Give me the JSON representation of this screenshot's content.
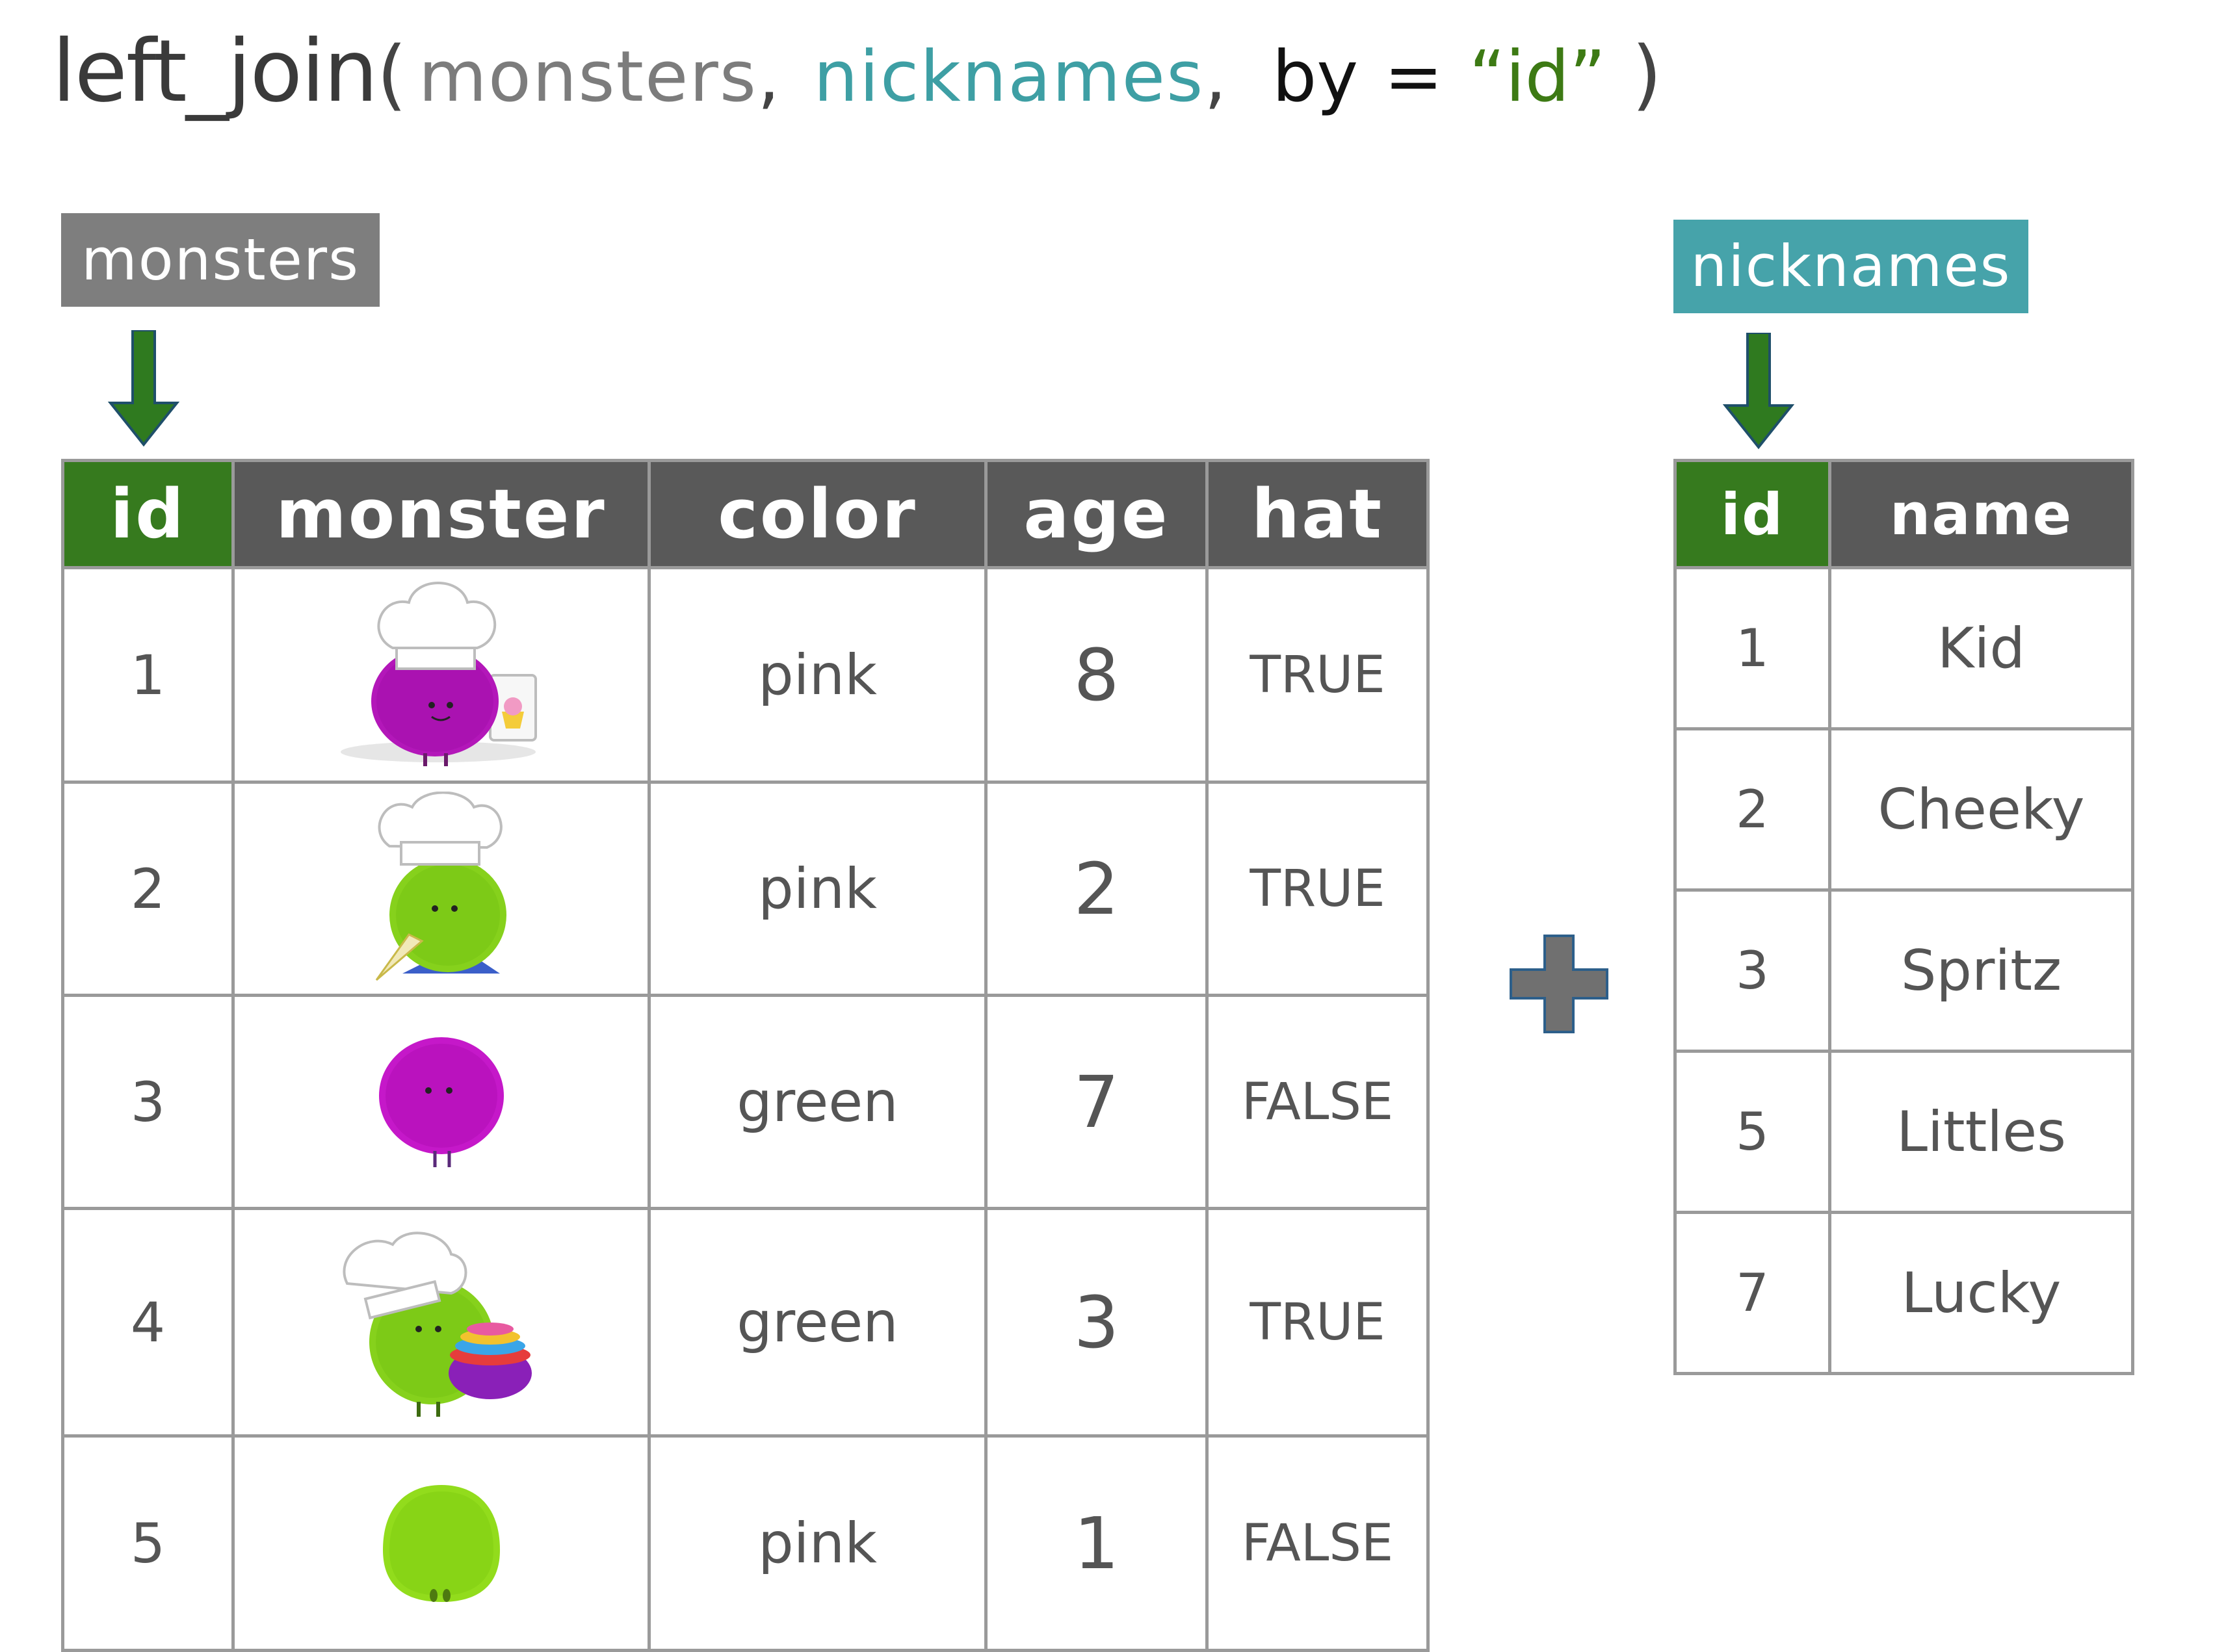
{
  "formula": {
    "fn": "left_join",
    "open_paren": "(",
    "arg1": "monsters",
    "comma1": ",",
    "arg2": "nicknames",
    "comma2": ",",
    "by_kw": "by",
    "equals": "=",
    "by_value": "“id”",
    "close_paren": ")"
  },
  "monsters": {
    "label": "monsters",
    "headers": [
      "id",
      "monster",
      "color",
      "age",
      "hat"
    ],
    "rows": [
      {
        "id": "1",
        "monster": "purple chef monster holding cupcake drawing",
        "color": "pink",
        "age": "8",
        "hat": "TRUE"
      },
      {
        "id": "2",
        "monster": "green chef monster with piping bag",
        "color": "pink",
        "age": "2",
        "hat": "TRUE"
      },
      {
        "id": "3",
        "monster": "magenta fuzzy monster",
        "color": "green",
        "age": "7",
        "hat": "FALSE"
      },
      {
        "id": "4",
        "monster": "green chef monster holding mixing bowls",
        "color": "green",
        "age": "3",
        "hat": "TRUE"
      },
      {
        "id": "5",
        "monster": "lime fuzzy monster",
        "color": "pink",
        "age": "1",
        "hat": "FALSE"
      }
    ]
  },
  "nicknames": {
    "label": "nicknames",
    "headers": [
      "id",
      "name"
    ],
    "rows": [
      {
        "id": "1",
        "name": "Kid"
      },
      {
        "id": "2",
        "name": "Cheeky"
      },
      {
        "id": "3",
        "name": "Spritz"
      },
      {
        "id": "5",
        "name": "Littles"
      },
      {
        "id": "7",
        "name": "Lucky"
      }
    ]
  },
  "colors": {
    "id_header": "#367a1e",
    "header": "#595959",
    "monsters_label": "#7e7e7e",
    "nicknames_label": "#46a3aa",
    "arrow": "#2f7a1f",
    "plus": "#707070"
  },
  "icons": [
    "down-arrow-icon",
    "plus-icon"
  ]
}
